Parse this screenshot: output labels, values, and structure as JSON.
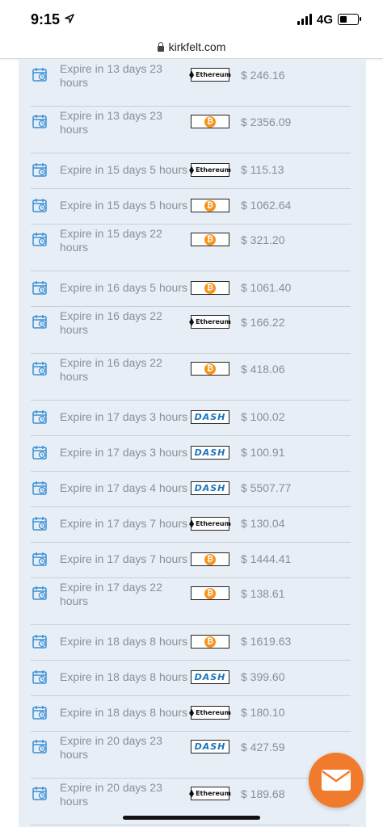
{
  "status": {
    "time": "9:15",
    "network": "4G"
  },
  "browser": {
    "url": "kirkfelt.com"
  },
  "coin_labels": {
    "ethereum": "Ethereum",
    "bitcoin": "₿",
    "dash": "DASH"
  },
  "colors": {
    "panel": "#e8eef5",
    "icon_blue": "#3b8fd6",
    "bitcoin": "#f7931a",
    "dash": "#1c75bc",
    "fab": "#f07b2c"
  },
  "orders": [
    {
      "expire": "Expire in 13 days 23 hours",
      "coin": "ethereum",
      "price": "$ 246.16"
    },
    {
      "expire": "Expire in 13 days 23 hours",
      "coin": "bitcoin",
      "price": "$ 2356.09"
    },
    {
      "expire": "Expire in 15 days 5 hours",
      "coin": "ethereum",
      "price": "$ 115.13"
    },
    {
      "expire": "Expire in 15 days 5 hours",
      "coin": "bitcoin",
      "price": "$ 1062.64"
    },
    {
      "expire": "Expire in 15 days 22 hours",
      "coin": "bitcoin",
      "price": "$ 321.20"
    },
    {
      "expire": "Expire in 16 days 5 hours",
      "coin": "bitcoin",
      "price": "$ 1061.40"
    },
    {
      "expire": "Expire in 16 days 22 hours",
      "coin": "ethereum",
      "price": "$ 166.22"
    },
    {
      "expire": "Expire in 16 days 22 hours",
      "coin": "bitcoin",
      "price": "$ 418.06"
    },
    {
      "expire": "Expire in 17 days 3 hours",
      "coin": "dash",
      "price": "$ 100.02"
    },
    {
      "expire": "Expire in 17 days 3 hours",
      "coin": "dash",
      "price": "$ 100.91"
    },
    {
      "expire": "Expire in 17 days 4 hours",
      "coin": "dash",
      "price": "$ 5507.77"
    },
    {
      "expire": "Expire in 17 days 7 hours",
      "coin": "ethereum",
      "price": "$ 130.04"
    },
    {
      "expire": "Expire in 17 days 7 hours",
      "coin": "bitcoin",
      "price": "$ 1444.41"
    },
    {
      "expire": "Expire in 17 days 22 hours",
      "coin": "bitcoin",
      "price": "$ 138.61"
    },
    {
      "expire": "Expire in 18 days 8 hours",
      "coin": "bitcoin",
      "price": "$ 1619.63"
    },
    {
      "expire": "Expire in 18 days 8 hours",
      "coin": "dash",
      "price": "$ 399.60"
    },
    {
      "expire": "Expire in 18 days 8 hours",
      "coin": "ethereum",
      "price": "$ 180.10"
    },
    {
      "expire": "Expire in 20 days 23 hours",
      "coin": "dash",
      "price": "$ 427.59"
    },
    {
      "expire": "Expire in 20 days 23 hours",
      "coin": "ethereum",
      "price": "$ 189.68"
    }
  ]
}
